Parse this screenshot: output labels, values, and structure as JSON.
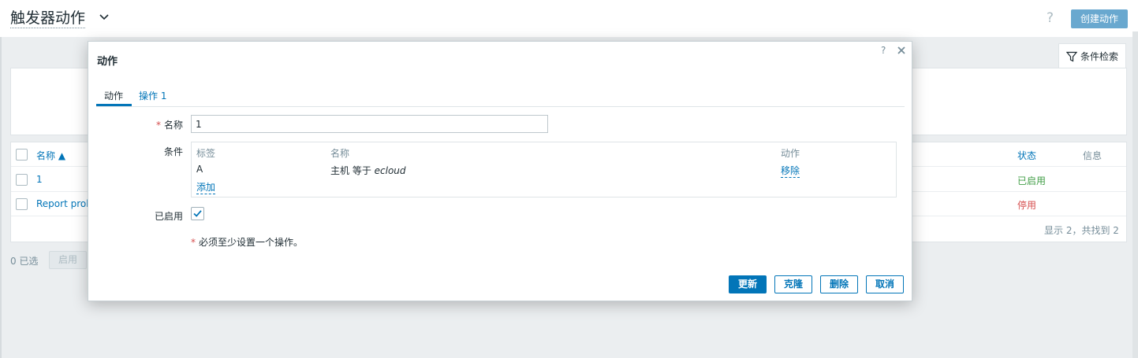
{
  "header": {
    "title": "触发器动作",
    "help": "?",
    "create_button": "创建动作"
  },
  "filter": {
    "label": "条件检索"
  },
  "table": {
    "columns": {
      "name": "名称 ▲",
      "status": "状态",
      "info": "信息"
    },
    "rows": [
      {
        "name": "1",
        "status": "已启用"
      },
      {
        "name": "Report prob",
        "status": "停用"
      }
    ],
    "summary": "显示 2，共找到 2"
  },
  "bottom": {
    "selected": "0 已选",
    "enable_button": "启用"
  },
  "modal": {
    "title": "动作",
    "help": "?",
    "tabs": {
      "action": "动作",
      "operations": "操作 1"
    },
    "form": {
      "name_label": "名称",
      "name_value": "1",
      "conditions_label": "条件",
      "conditions": {
        "headers": {
          "label": "标签",
          "name": "名称",
          "action": "动作"
        },
        "rows": [
          {
            "label": "A",
            "name_prefix": "主机 等于 ",
            "name_value": "ecloud",
            "action": "移除"
          }
        ],
        "add_link": "添加"
      },
      "enabled_label": "已启用",
      "enabled": true,
      "required_note": "必须至少设置一个操作。"
    },
    "buttons": {
      "update": "更新",
      "clone": "克隆",
      "delete": "删除",
      "cancel": "取消"
    }
  },
  "colors": {
    "accent": "#0275b8",
    "enabled": "#429e47",
    "disabled": "#d64e4e"
  }
}
